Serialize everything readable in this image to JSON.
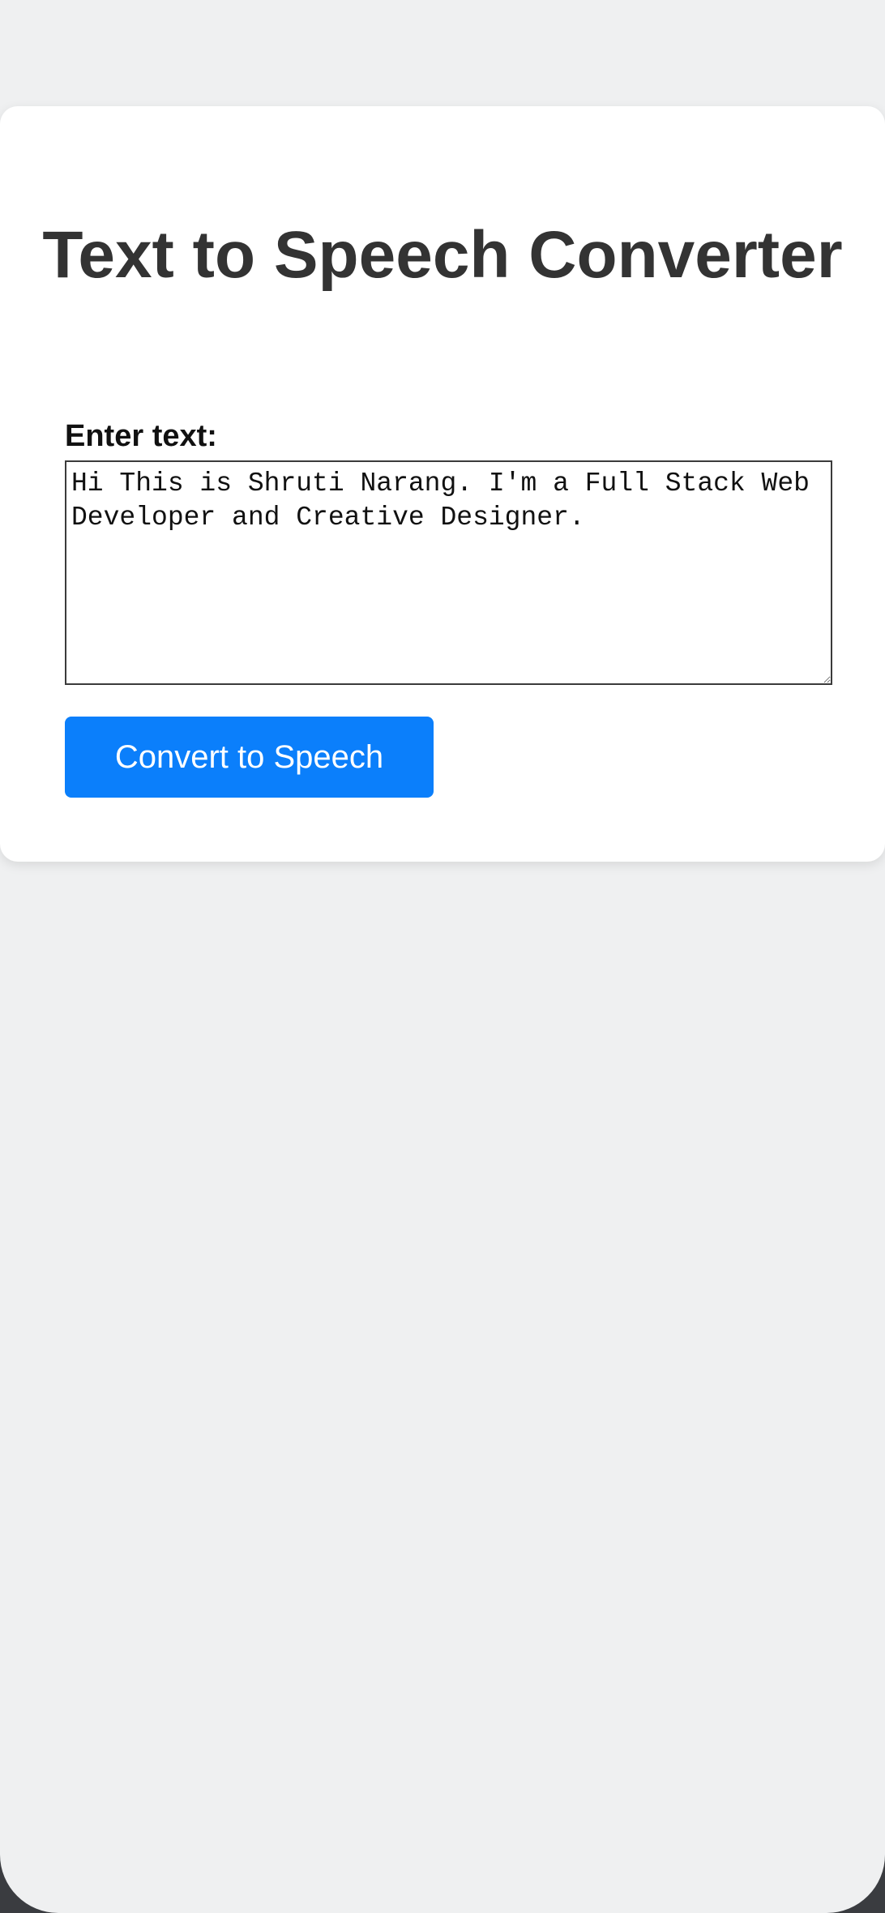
{
  "app": {
    "title": "Text to Speech Converter"
  },
  "form": {
    "label": "Enter text:",
    "text_value": "Hi This is Shruti Narang. I'm a Full Stack Web Developer and Creative Designer.",
    "convert_label": "Convert to Speech"
  },
  "colors": {
    "accent": "#0b7ffb",
    "card_background": "#ffffff",
    "page_background": "#eff0f1",
    "title_text": "#333333"
  }
}
